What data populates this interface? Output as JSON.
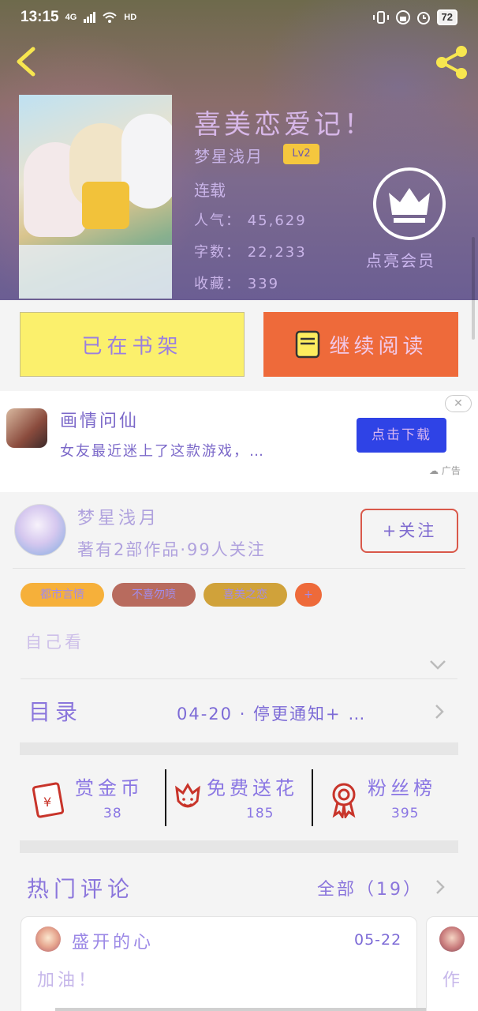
{
  "status_bar": {
    "time": "13:15",
    "network": "4G",
    "hd": "HD",
    "battery": "72"
  },
  "book": {
    "title": "喜美恋爱记！",
    "author": "梦星浅月",
    "level": "Lv2",
    "status": "连载",
    "popularity": "人气： 45,629",
    "words": "字数： 22,233",
    "favorites": "收藏： 339",
    "vip_label": "点亮会员"
  },
  "buttons": {
    "shelf": "已在书架",
    "read": "继续阅读"
  },
  "ad": {
    "title": "画情问仙",
    "desc": "女友最近迷上了这款游戏，…",
    "cta": "点击下载",
    "close": "✕",
    "label": "广告"
  },
  "author_info": {
    "name": "梦星浅月",
    "meta": "著有2部作品·99人关注",
    "follow": "+关注"
  },
  "tags": [
    "都市言情",
    "不喜勿喷",
    "喜美之恋",
    "+"
  ],
  "description": "自己看",
  "catalog": {
    "title": "目录",
    "latest": "04-20 · 停更通知+ …"
  },
  "actions": [
    {
      "label": "赏金币",
      "count": "38"
    },
    {
      "label": "免费送花",
      "count": "185"
    },
    {
      "label": "粉丝榜",
      "count": "395"
    }
  ],
  "comments": {
    "title": "热门评论",
    "all": "全部（19）",
    "items": [
      {
        "user": "盛开的心",
        "date": "05-22",
        "text": "加油！"
      },
      {
        "text": "作"
      }
    ]
  },
  "colors": {
    "accent_orange": "#ee6a3a",
    "shelf_yellow": "#fbf06c",
    "ad_blue": "#2f43e6",
    "text_purple": "#8b76dc"
  }
}
